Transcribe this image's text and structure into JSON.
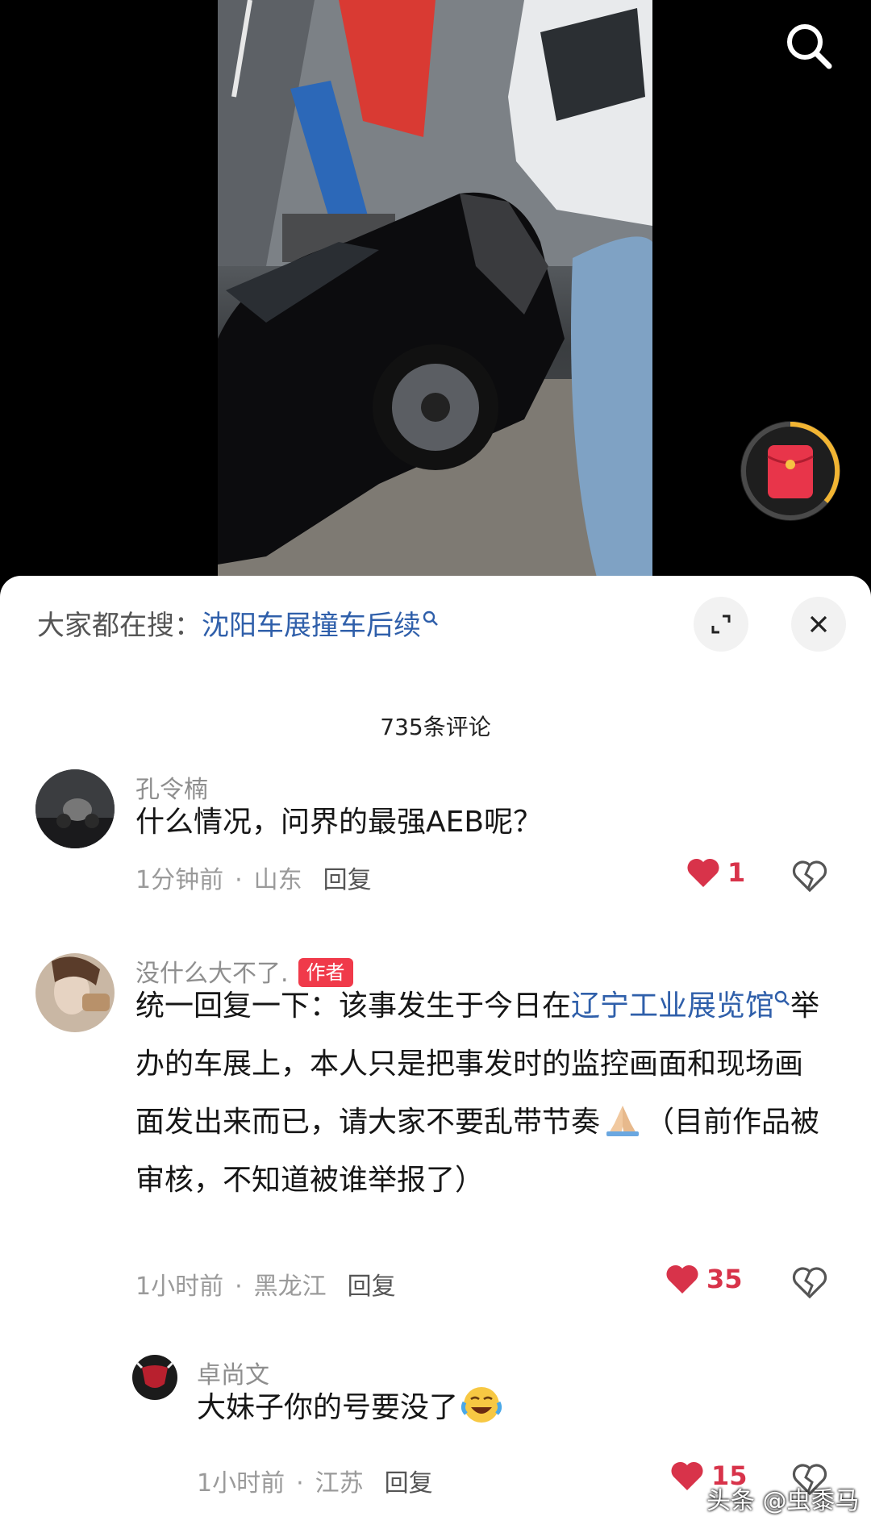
{
  "trending": {
    "prefix": "大家都在搜：",
    "keyword": "沈阳车展撞车后续"
  },
  "comment_count": "735条评论",
  "comments": [
    {
      "name": "孔令楠",
      "text": "什么情况，问界的最强AEB呢？",
      "time": "1分钟前",
      "location": "山东",
      "reply": "回复",
      "likes": "1"
    },
    {
      "name": "没什么大不了.",
      "tag": "作者",
      "text_1": "统一回复一下：该事发生于今日在",
      "link": "辽宁工业展览馆",
      "text_2": "举办的车展上，本人只是把事发时的监控画面和现场画面发出来而已，请大家不要乱带节奏",
      "text_3": "（目前作品被审核，不知道被谁举报了）",
      "time": "1小时前",
      "location": "黑龙江",
      "reply": "回复",
      "likes": "35"
    },
    {
      "name": "卓尚文",
      "text": "大妹子你的号要没了",
      "time": "1小时前",
      "location": "江苏",
      "reply": "回复",
      "likes": "15"
    }
  ],
  "watermark": "头条 @虫黍马",
  "colors": {
    "link": "#2f5faa",
    "like": "#d8334a",
    "author_tag": "#f03a4a"
  },
  "icons": [
    "search-icon",
    "red-packet-icon",
    "expand-icon",
    "close-icon",
    "heart-icon",
    "broken-heart-icon"
  ]
}
